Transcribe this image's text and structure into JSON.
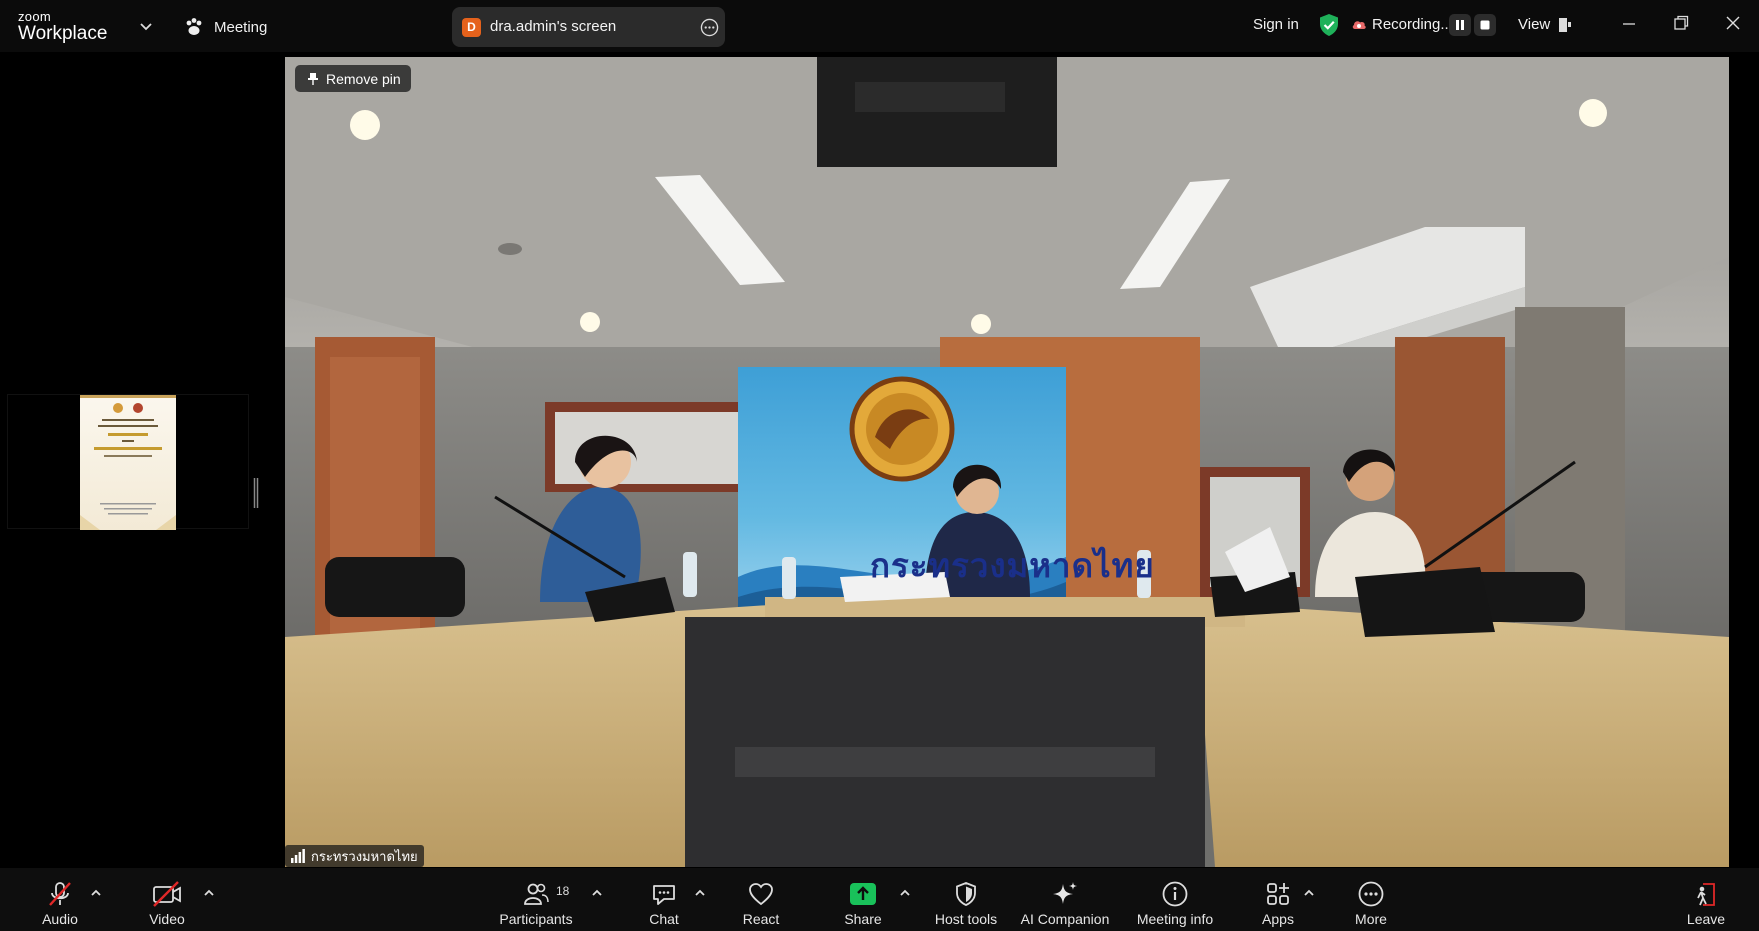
{
  "topbar": {
    "logo_top": "zoom",
    "logo_bottom": "Workplace",
    "meeting_label": "Meeting",
    "screen_avatar_letter": "D",
    "screen_label": "dra.admin's screen",
    "sign_in": "Sign in",
    "recording_label": "Recording...",
    "view_label": "View"
  },
  "main": {
    "remove_pin": "Remove pin",
    "participant_name": "กระทรวงมหาดไทย",
    "backdrop_text": "กระทรวงมหาดไทย"
  },
  "toolbar": {
    "audio": "Audio",
    "video": "Video",
    "participants": "Participants",
    "participants_count": "18",
    "chat": "Chat",
    "react": "React",
    "share": "Share",
    "host_tools": "Host tools",
    "ai_companion": "AI Companion",
    "meeting_info": "Meeting info",
    "apps": "Apps",
    "more": "More",
    "leave": "Leave"
  },
  "colors": {
    "share_green": "#19c15a",
    "muted_red": "#e02828",
    "security_green": "#1fb15a",
    "avatar_orange": "#e5621c"
  },
  "icons": [
    "caret-down-icon",
    "meeting-paw-icon",
    "more-icon",
    "shield-check-icon",
    "cloud-record-icon",
    "pause-icon",
    "stop-icon",
    "view-layout-icon",
    "minimize-icon",
    "maximize-icon",
    "close-icon",
    "pin-icon",
    "signal-icon",
    "mic-muted-icon",
    "camera-off-icon",
    "participants-icon",
    "chat-icon",
    "heart-icon",
    "share-arrow-icon",
    "host-shield-icon",
    "sparkle-icon",
    "info-icon",
    "apps-icon",
    "ellipsis-icon",
    "leave-icon"
  ]
}
